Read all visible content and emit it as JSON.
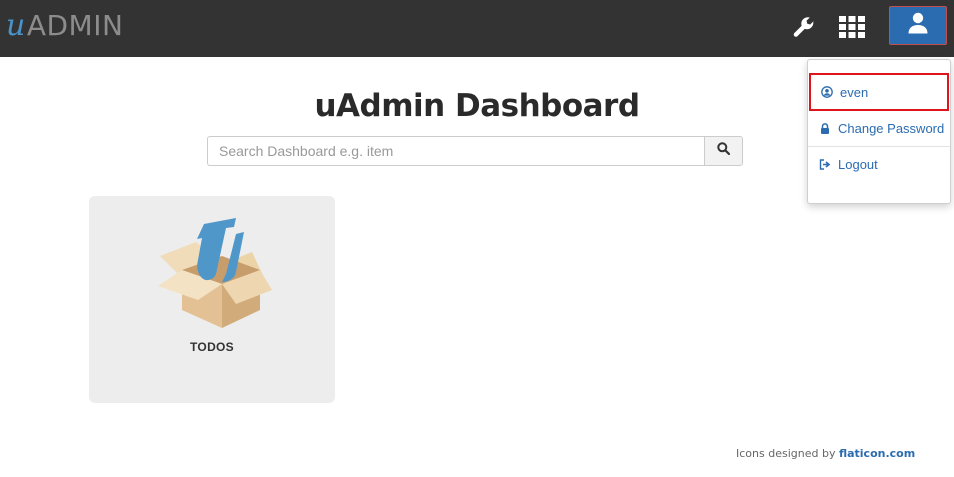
{
  "app": {
    "logo_prefix": "u",
    "logo_text": "ADMIN"
  },
  "topbar": {
    "icons": [
      "wrench-icon",
      "apps-grid-icon",
      "user-icon"
    ]
  },
  "main": {
    "title": "uAdmin Dashboard",
    "search": {
      "placeholder": "Search Dashboard e.g. item",
      "value": ""
    },
    "cards": [
      {
        "label": "TODOS",
        "icon": "box-icon"
      }
    ]
  },
  "footer": {
    "text": "Icons designed by ",
    "link": "flaticon.com"
  },
  "user_menu": {
    "items": [
      {
        "label": "even",
        "icon": "user-circle-icon"
      },
      {
        "label": "Change Password",
        "icon": "lock-icon"
      },
      {
        "label": "Logout",
        "icon": "sign-out-icon"
      }
    ]
  },
  "colors": {
    "topbar_bg": "#333333",
    "accent": "#2b6cb0",
    "highlight_border": "#e0141c",
    "card_bg": "#ededed"
  }
}
